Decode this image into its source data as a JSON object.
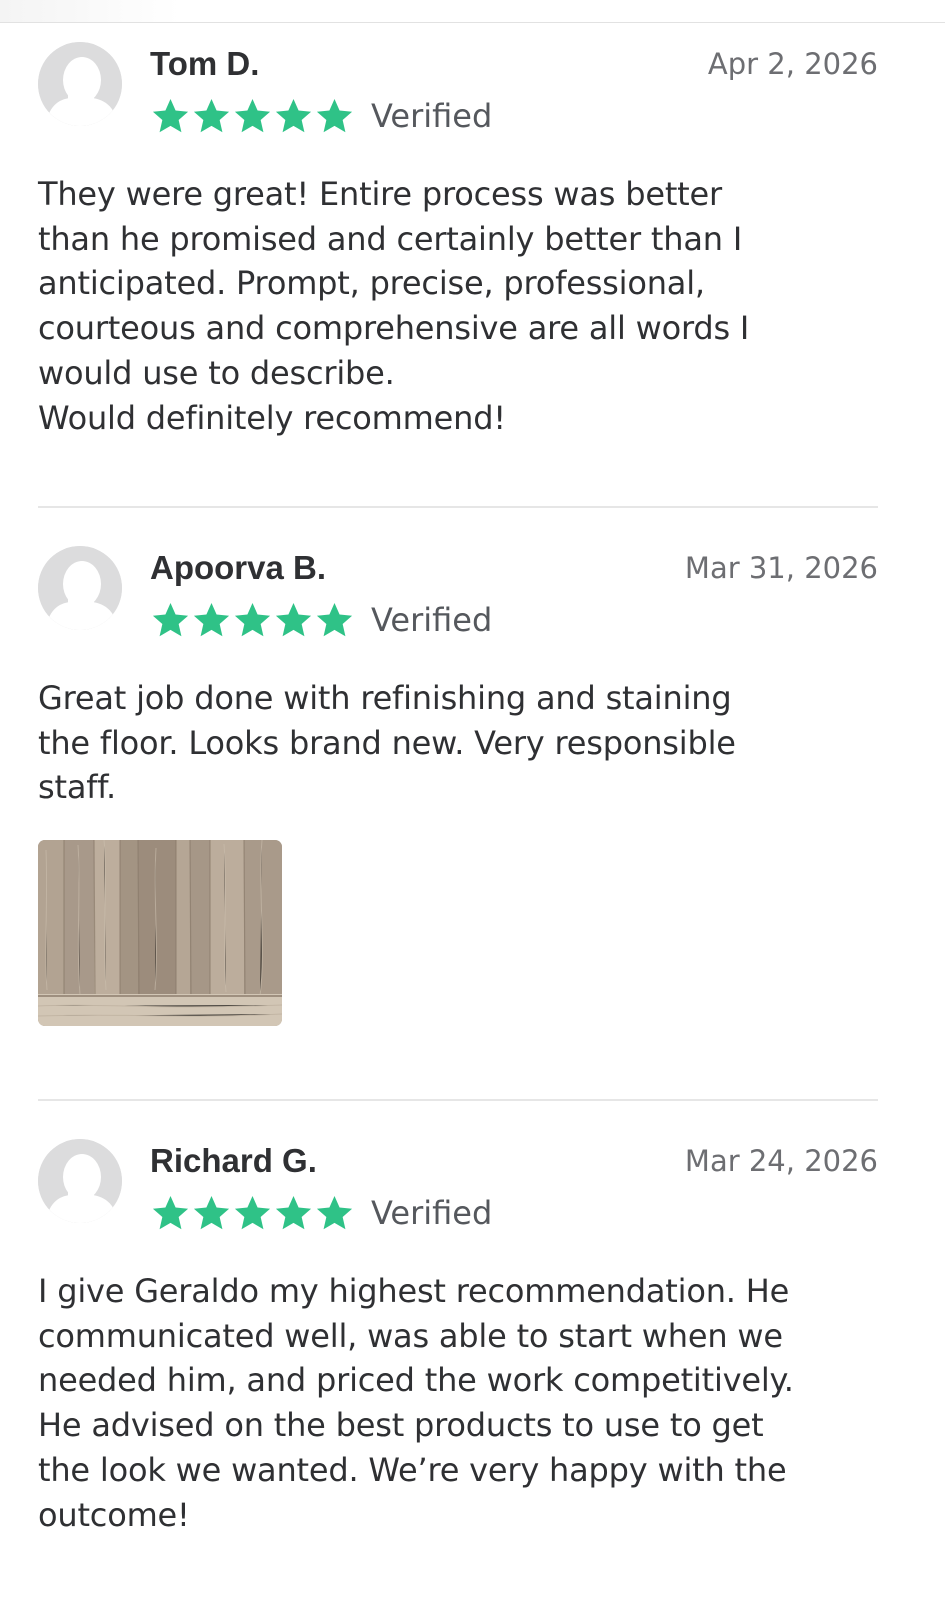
{
  "reviews": [
    {
      "name": "Tom D.",
      "date": "Apr 2, 2026",
      "rating": 5,
      "verified_label": "Verified",
      "text": "They were great! Entire process was better\nthan he promised and certainly better than I\nanticipated. Prompt, precise, professional,\ncourteous and comprehensive are all words I\nwould use to describe.\nWould definitely recommend!",
      "photo_count": 0
    },
    {
      "name": "Apoorva B.",
      "date": "Mar 31, 2026",
      "rating": 5,
      "verified_label": "Verified",
      "text": "Great job done with refinishing and staining\nthe floor. Looks brand new. Very responsible\nstaff.",
      "photo_count": 1
    },
    {
      "name": "Richard G.",
      "date": "Mar 24, 2026",
      "rating": 5,
      "verified_label": "Verified",
      "text": "I give Geraldo my highest recommendation. He\ncommunicated well, was able to start when we\nneeded him, and priced the work competitively.\nHe advised on the best products to use to get\nthe look we wanted. We’re very happy with the\noutcome!",
      "photo_count": 0
    }
  ],
  "colors": {
    "star": "#2fc287",
    "name": "#2f3033",
    "date": "#6d6e72",
    "divider": "#e6e6e6",
    "avatar": "#dcdcdd"
  },
  "icons": {
    "avatar": "default-user-avatar-icon",
    "star": "star-icon",
    "photo": "wood-floor-photo"
  }
}
